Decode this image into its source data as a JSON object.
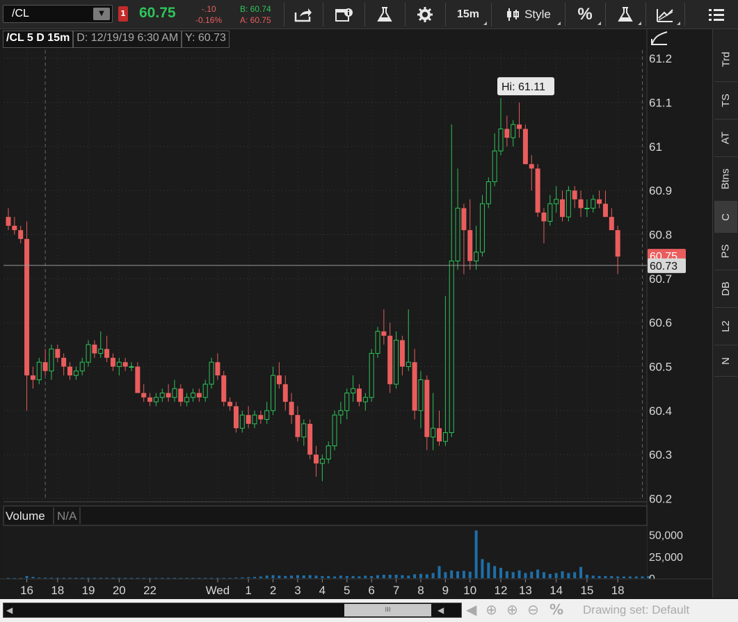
{
  "toolbar": {
    "symbol": "/CL",
    "alert_count": "1",
    "last_price": "60.75",
    "net_change": "-.10",
    "net_change_pct": "-0.16%",
    "bid": "B: 60.74",
    "ask": "A: 60.75",
    "timeframe_label": "15m",
    "style_label": "Style",
    "percent_label": "%",
    "up_color": "#2ec45a",
    "down_color": "#ea5d5d"
  },
  "chart_header": {
    "title": "/CL 5 D 15m",
    "date": "D: 12/19/19 6:30 AM",
    "y": "Y: 60.73"
  },
  "side_tabs": [
    "Trd",
    "TS",
    "AT",
    "Btns",
    "C",
    "PS",
    "DB",
    "L2",
    "N"
  ],
  "volume_panel": {
    "label": "Volume",
    "value": "N/A"
  },
  "scroll": {
    "thumb_label": "III",
    "drawing_set": "Drawing set: Default"
  },
  "chart_data": {
    "type": "candlestick",
    "title": "/CL 5 D 15m",
    "ylim": [
      60.2,
      61.22
    ],
    "yticks": [
      61.2,
      61.1,
      61,
      60.9,
      60.8,
      60.7,
      60.6,
      60.5,
      60.4,
      60.3,
      60.2
    ],
    "ytick_labels": [
      "61.2",
      "61.1",
      "61",
      "60.9",
      "60.8",
      "60.7",
      "60.6",
      "60.5",
      "60.4",
      "60.3",
      "60.2"
    ],
    "x_labels": [
      "16",
      "18",
      "19",
      "20",
      "22",
      "Wed",
      "1",
      "2",
      "3",
      "4",
      "5",
      "6",
      "7",
      "8",
      "9",
      "10",
      "12",
      "13",
      "14",
      "15",
      "18"
    ],
    "price_labels": {
      "last": "60.75",
      "crosshair": "60.73"
    },
    "crosshair_y": 60.73,
    "high_annotation": {
      "text": "Hi: 61.11",
      "value": 61.11
    },
    "candles": [
      [
        60.84,
        60.86,
        60.81,
        60.82
      ],
      [
        60.82,
        60.84,
        60.8,
        60.81
      ],
      [
        60.81,
        60.82,
        60.78,
        60.79
      ],
      [
        60.79,
        60.83,
        60.4,
        60.48
      ],
      [
        60.48,
        60.5,
        60.45,
        60.47
      ],
      [
        60.47,
        60.52,
        60.46,
        60.51
      ],
      [
        60.51,
        60.54,
        60.48,
        60.49
      ],
      [
        60.49,
        60.55,
        60.47,
        60.54
      ],
      [
        60.54,
        60.55,
        60.51,
        60.52
      ],
      [
        60.52,
        60.53,
        60.48,
        60.5
      ],
      [
        60.5,
        60.51,
        60.47,
        60.48
      ],
      [
        60.48,
        60.5,
        60.47,
        60.49
      ],
      [
        60.49,
        60.52,
        60.48,
        60.51
      ],
      [
        60.51,
        60.56,
        60.5,
        60.55
      ],
      [
        60.55,
        60.56,
        60.52,
        60.53
      ],
      [
        60.53,
        60.58,
        60.52,
        60.54
      ],
      [
        60.54,
        60.57,
        60.51,
        60.52
      ],
      [
        60.52,
        60.53,
        60.49,
        60.5
      ],
      [
        60.5,
        60.52,
        60.48,
        60.51
      ],
      [
        60.51,
        60.52,
        60.49,
        60.5
      ],
      [
        60.5,
        60.51,
        60.49,
        60.5
      ],
      [
        60.5,
        60.51,
        60.44,
        60.44
      ],
      [
        60.44,
        60.46,
        60.42,
        60.43
      ],
      [
        60.43,
        60.44,
        60.41,
        60.42
      ],
      [
        60.42,
        60.44,
        60.41,
        60.43
      ],
      [
        60.43,
        60.45,
        60.42,
        60.44
      ],
      [
        60.44,
        60.46,
        60.42,
        60.43
      ],
      [
        60.43,
        60.47,
        60.42,
        60.45
      ],
      [
        60.45,
        60.46,
        60.41,
        60.42
      ],
      [
        60.42,
        60.44,
        60.41,
        60.43
      ],
      [
        60.43,
        60.45,
        60.42,
        60.44
      ],
      [
        60.44,
        60.45,
        60.42,
        60.43
      ],
      [
        60.43,
        60.47,
        60.42,
        60.46
      ],
      [
        60.46,
        60.52,
        60.45,
        60.51
      ],
      [
        60.51,
        60.53,
        60.47,
        60.48
      ],
      [
        60.48,
        60.49,
        60.41,
        60.42
      ],
      [
        60.42,
        60.43,
        60.4,
        60.41
      ],
      [
        60.41,
        60.42,
        60.35,
        60.36
      ],
      [
        60.36,
        60.4,
        60.35,
        60.39
      ],
      [
        60.39,
        60.41,
        60.36,
        60.37
      ],
      [
        60.37,
        60.4,
        60.36,
        60.39
      ],
      [
        60.39,
        60.4,
        60.37,
        60.38
      ],
      [
        60.38,
        60.42,
        60.37,
        60.4
      ],
      [
        60.4,
        60.5,
        60.39,
        60.48
      ],
      [
        60.48,
        60.51,
        60.45,
        60.46
      ],
      [
        60.46,
        60.48,
        60.4,
        60.42
      ],
      [
        60.42,
        60.44,
        60.37,
        60.39
      ],
      [
        60.39,
        60.41,
        60.33,
        60.34
      ],
      [
        60.34,
        60.38,
        60.32,
        60.37
      ],
      [
        60.37,
        60.38,
        60.29,
        60.3
      ],
      [
        60.3,
        60.32,
        60.25,
        60.28
      ],
      [
        60.28,
        60.3,
        60.24,
        60.29
      ],
      [
        60.29,
        60.33,
        60.28,
        60.32
      ],
      [
        60.32,
        60.4,
        60.31,
        60.39
      ],
      [
        60.39,
        60.42,
        60.37,
        60.4
      ],
      [
        60.4,
        60.45,
        60.38,
        60.44
      ],
      [
        60.44,
        60.48,
        60.42,
        60.45
      ],
      [
        60.45,
        60.46,
        60.41,
        60.42
      ],
      [
        60.42,
        60.44,
        60.4,
        60.43
      ],
      [
        60.43,
        60.54,
        60.42,
        60.53
      ],
      [
        60.53,
        60.59,
        60.52,
        60.58
      ],
      [
        60.58,
        60.63,
        60.55,
        60.57
      ],
      [
        60.57,
        60.6,
        60.44,
        60.46
      ],
      [
        60.46,
        60.58,
        60.45,
        60.56
      ],
      [
        60.56,
        60.57,
        60.48,
        60.5
      ],
      [
        60.5,
        60.63,
        60.49,
        60.51
      ],
      [
        60.51,
        60.54,
        60.38,
        60.4
      ],
      [
        60.4,
        60.49,
        60.36,
        60.47
      ],
      [
        60.47,
        60.48,
        60.31,
        60.34
      ],
      [
        60.34,
        60.44,
        60.31,
        60.36
      ],
      [
        60.36,
        60.4,
        60.32,
        60.33
      ],
      [
        60.33,
        60.66,
        60.32,
        60.35
      ],
      [
        60.35,
        61.05,
        60.34,
        60.74
      ],
      [
        60.74,
        60.95,
        60.72,
        60.86
      ],
      [
        60.86,
        60.87,
        60.71,
        60.81
      ],
      [
        60.81,
        60.88,
        60.72,
        60.74
      ],
      [
        60.74,
        60.82,
        60.72,
        60.76
      ],
      [
        60.76,
        60.89,
        60.75,
        60.87
      ],
      [
        60.87,
        60.93,
        60.86,
        60.92
      ],
      [
        60.92,
        61.03,
        60.91,
        60.99
      ],
      [
        60.99,
        61.11,
        60.98,
        61.04
      ],
      [
        61.04,
        61.07,
        61.0,
        61.02
      ],
      [
        61.02,
        61.06,
        61.0,
        61.05
      ],
      [
        61.05,
        61.1,
        61.02,
        61.04
      ],
      [
        61.04,
        61.05,
        60.96,
        60.96
      ],
      [
        60.96,
        60.98,
        60.9,
        60.95
      ],
      [
        60.95,
        60.96,
        60.84,
        60.85
      ],
      [
        60.85,
        60.86,
        60.78,
        60.83
      ],
      [
        60.83,
        60.89,
        60.82,
        60.87
      ],
      [
        60.87,
        60.91,
        60.85,
        60.88
      ],
      [
        60.88,
        60.9,
        60.83,
        60.84
      ],
      [
        60.84,
        60.91,
        60.83,
        60.9
      ],
      [
        60.9,
        60.91,
        60.86,
        60.88
      ],
      [
        60.88,
        60.9,
        60.84,
        60.86
      ],
      [
        60.86,
        60.88,
        60.84,
        60.86
      ],
      [
        60.86,
        60.89,
        60.85,
        60.88
      ],
      [
        60.88,
        60.9,
        60.86,
        60.87
      ],
      [
        60.87,
        60.9,
        60.84,
        60.84
      ],
      [
        60.84,
        60.86,
        60.81,
        60.81
      ],
      [
        60.81,
        60.82,
        60.71,
        60.75
      ]
    ],
    "volume": {
      "yticks": [
        50000,
        25000,
        0
      ],
      "ytick_labels": [
        "50,000",
        "25,000",
        "0"
      ],
      "ylim": [
        0,
        60000
      ],
      "values": [
        300,
        200,
        200,
        2500,
        1500,
        800,
        600,
        500,
        500,
        400,
        400,
        400,
        400,
        400,
        400,
        400,
        400,
        400,
        400,
        400,
        300,
        300,
        300,
        300,
        300,
        300,
        300,
        300,
        300,
        300,
        300,
        300,
        300,
        300,
        300,
        300,
        300,
        800,
        1000,
        1200,
        1500,
        2000,
        3000,
        3500,
        3000,
        2500,
        3000,
        3500,
        3200,
        3500,
        3000,
        2500,
        2500,
        2000,
        3000,
        2500,
        2500,
        2200,
        2800,
        2500,
        3500,
        4000,
        4000,
        4000,
        3500,
        3000,
        4500,
        5000,
        4500,
        6000,
        14000,
        7000,
        9000,
        8000,
        8500,
        7500,
        55000,
        22000,
        18000,
        14000,
        12000,
        8000,
        7000,
        9000,
        6000,
        7500,
        10000,
        7000,
        5000,
        6000,
        8000,
        6000,
        7000,
        13000,
        4000,
        3000,
        2500,
        2500,
        2500,
        2000,
        2000,
        2000,
        2000,
        2000,
        2500
      ]
    }
  }
}
